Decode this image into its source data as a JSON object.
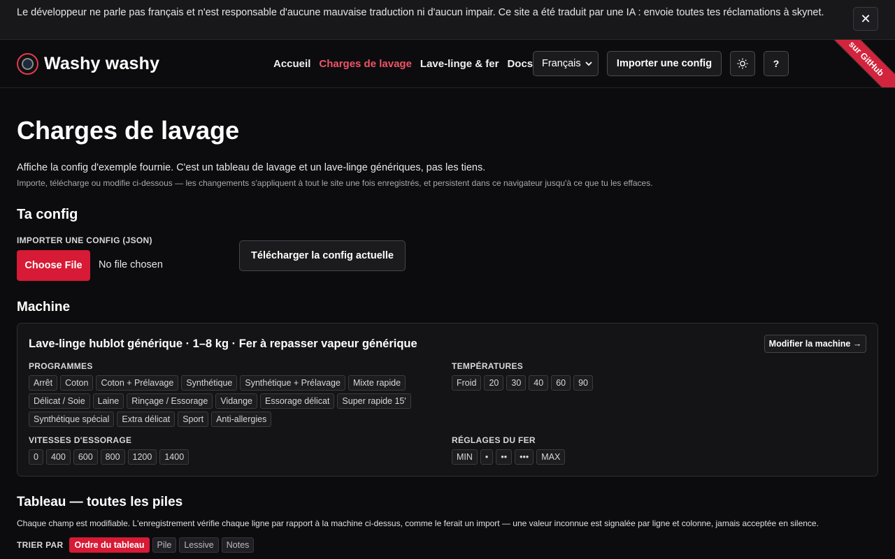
{
  "banner": {
    "text": "Le développeur ne parle pas français et n'est responsable d'aucune mauvaise traduction ni d'aucun impair. Ce site a été traduit par une IA : envoie toutes tes réclamations à skynet.",
    "close_glyph": "✕"
  },
  "header": {
    "brand": "Washy washy",
    "nav": [
      {
        "label": "Accueil",
        "active": false
      },
      {
        "label": "Charges de lavage",
        "active": true
      },
      {
        "label": "Lave-linge & fer",
        "active": false
      },
      {
        "label": "Docs",
        "active": false
      }
    ],
    "language": "Français",
    "import_label": "Importer une config",
    "theme_icon": "sun-icon",
    "help_label": "?",
    "ribbon_label": "sur GitHub"
  },
  "page": {
    "title": "Charges de lavage",
    "intro": "Affiche la config d'exemple fournie. C'est un tableau de lavage et un lave-linge génériques, pas les tiens.",
    "intro_sub": "Importe, télécharge ou modifie ci-dessous — les changements s'appliquent à tout le site une fois enregistrés, et persistent dans ce navigateur jusqu'à ce que tu les effaces."
  },
  "config": {
    "heading": "Ta config",
    "import_label": "IMPORTER UNE CONFIG (JSON)",
    "choose_file": "Choose File",
    "no_file": "No file chosen",
    "download_label": "Télécharger la config actuelle"
  },
  "machine": {
    "heading": "Machine",
    "title": "Lave-linge hublot générique · 1–8 kg · Fer à repasser vapeur générique",
    "edit_label": "Modifier la machine →",
    "programs_label": "PROGRAMMES",
    "programs": [
      "Arrêt",
      "Coton",
      "Coton + Prélavage",
      "Synthétique",
      "Synthétique + Prélavage",
      "Mixte rapide",
      "Délicat / Soie",
      "Laine",
      "Rinçage / Essorage",
      "Vidange",
      "Essorage délicat",
      "Super rapide 15'",
      "Synthétique spécial",
      "Extra délicat",
      "Sport",
      "Anti-allergies"
    ],
    "temps_label": "TEMPÉRATURES",
    "temps": [
      "Froid",
      "20",
      "30",
      "40",
      "60",
      "90"
    ],
    "spins_label": "VITESSES D'ESSORAGE",
    "spins": [
      "0",
      "400",
      "600",
      "800",
      "1200",
      "1400"
    ],
    "iron_label": "RÉGLAGES DU FER",
    "iron": [
      "MIN",
      "•",
      "••",
      "•••",
      "MAX"
    ]
  },
  "table": {
    "heading": "Tableau — toutes les piles",
    "sub": "Chaque champ est modifiable. L'enregistrement vérifie chaque ligne par rapport à la machine ci-dessus, comme le ferait un import — une valeur inconnue est signalée par ligne et colonne, jamais acceptée en silence.",
    "sort_label": "TRIER PAR",
    "sort_options": [
      {
        "label": "Ordre du tableau",
        "active": true
      },
      {
        "label": "Pile",
        "active": false
      },
      {
        "label": "Lessive",
        "active": false
      },
      {
        "label": "Notes",
        "active": false
      }
    ]
  }
}
